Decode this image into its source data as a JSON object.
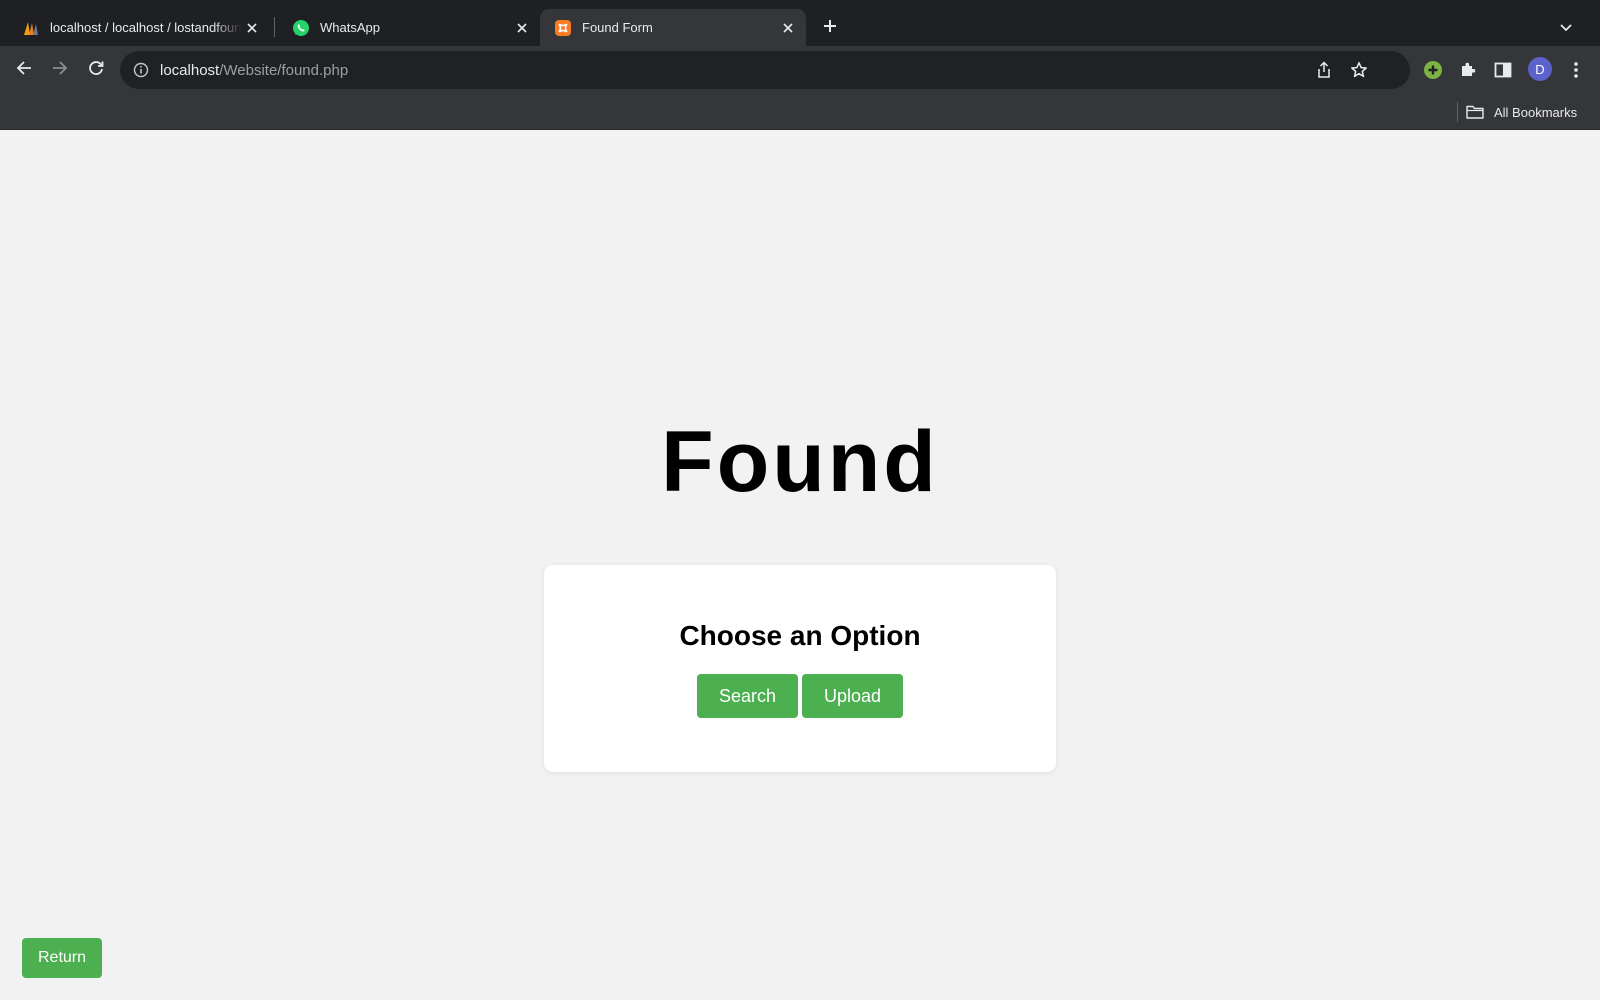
{
  "browser": {
    "tabs": [
      {
        "title": "localhost / localhost / lostandfound",
        "favicon": "phpmyadmin-icon",
        "active": false
      },
      {
        "title": "WhatsApp",
        "favicon": "whatsapp-icon",
        "active": false
      },
      {
        "title": "Found Form",
        "favicon": "xampp-icon",
        "active": true
      }
    ],
    "address": {
      "host": "localhost",
      "path": "/Website/found.php"
    },
    "profile_initial": "D",
    "bookmarks_label": "All Bookmarks"
  },
  "page": {
    "heading": "Found",
    "card_title": "Choose an Option",
    "search_label": "Search",
    "upload_label": "Upload",
    "return_label": "Return"
  },
  "colors": {
    "accent_green": "#4caf50",
    "page_bg": "#f2f2f2"
  }
}
